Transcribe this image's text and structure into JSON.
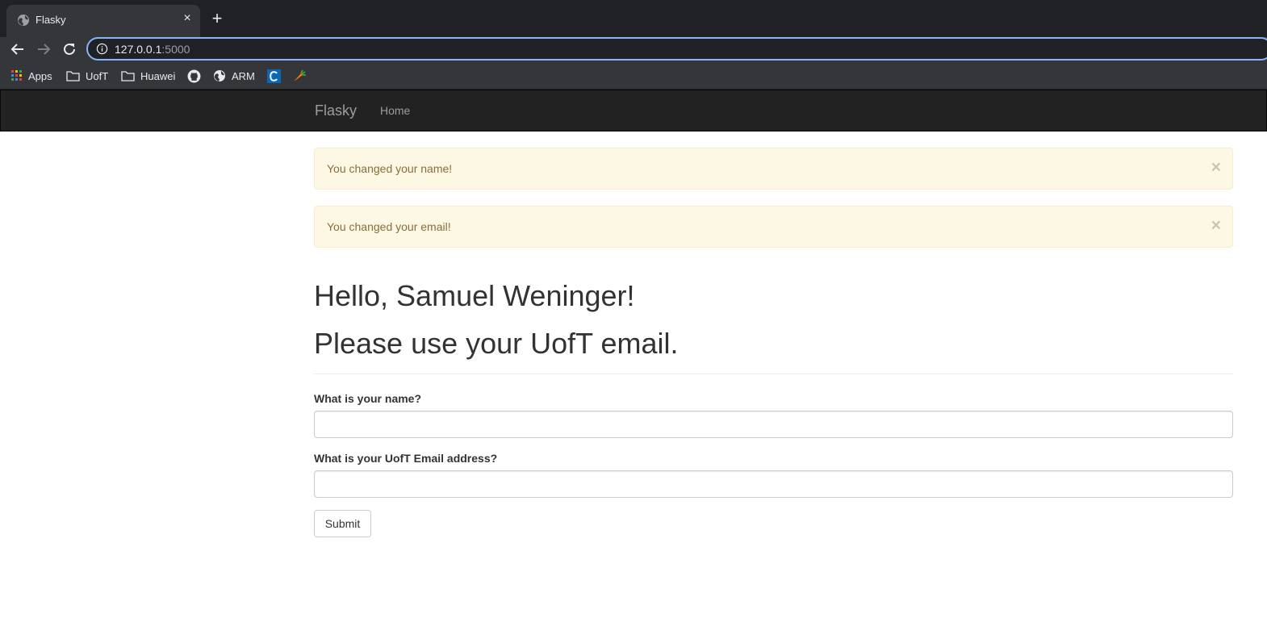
{
  "browser": {
    "tab_title": "Flasky",
    "tab_close": "×",
    "new_tab": "+",
    "url_host": "127.0.0.1",
    "url_port": ":5000",
    "bookmarks": {
      "apps": "Apps",
      "uoft": "UofT",
      "huawei": "Huawei",
      "arm": "ARM"
    }
  },
  "navbar": {
    "brand": "Flasky",
    "home": "Home"
  },
  "alerts": [
    {
      "message": "You changed your name!",
      "close": "×"
    },
    {
      "message": "You changed your email!",
      "close": "×"
    }
  ],
  "page": {
    "greeting": "Hello, Samuel Weninger!",
    "notice": "Please use your UofT email."
  },
  "form": {
    "name_label": "What is your name?",
    "name_value": "",
    "email_label": "What is your UofT Email address?",
    "email_value": "",
    "submit_label": "Submit"
  },
  "colors": {
    "navbar_bg": "#222222",
    "alert_bg": "#fcf8e3",
    "alert_text": "#8a6d3b",
    "omnibox_focus": "#8ab4f8"
  }
}
